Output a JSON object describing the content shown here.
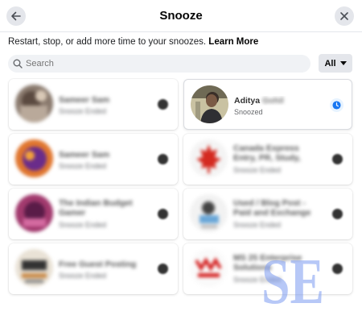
{
  "header": {
    "title": "Snooze"
  },
  "description": {
    "text": "Restart, stop, or add more time to your snoozes.",
    "link": "Learn More"
  },
  "search": {
    "placeholder": "Search"
  },
  "filter": {
    "label": "All"
  },
  "cards": [
    {
      "name": "Sameer Sam",
      "status": "Snooze Ended"
    },
    {
      "name": "Aditya Gohil",
      "first": "Aditya",
      "last": "Gohil",
      "status": "Snoozed"
    },
    {
      "name": "Sameer Sam",
      "status": "Snooze Ended"
    },
    {
      "name": "Canada Express Entry, PR, Study, Work, ...",
      "status": "Snooze Ended"
    },
    {
      "name": "The Indian Budget Gamer",
      "status": "Snooze Ended"
    },
    {
      "name": "Used / Blog Post - Paid and Exchange",
      "status": "Snooze Ended"
    },
    {
      "name": "Free Guest Posting",
      "status": "Snooze Ended"
    },
    {
      "name": "MS 25 Enterprise Solutions",
      "status": "Snooze Ended"
    }
  ],
  "watermark": {
    "text": "SE"
  },
  "colors": {
    "accent": "#1877f2",
    "clock_bg": "#e7f3ff",
    "surface": "#e4e6eb",
    "watermark": "#7c9bf0"
  }
}
